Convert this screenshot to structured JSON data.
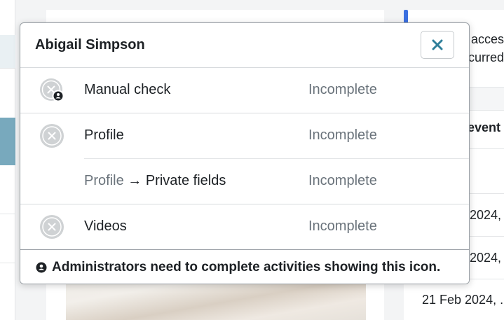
{
  "background": {
    "right_panel": {
      "line1": "acces",
      "line2": "curred",
      "header": "event",
      "dates": [
        "2024, .",
        "2024, .",
        "21 Feb 2024, ."
      ]
    }
  },
  "modal": {
    "title": "Abigail Simpson",
    "close_icon": "close-icon",
    "rows": [
      {
        "label": "Manual check",
        "status": "Incomplete",
        "icon": "incomplete-admin-icon"
      },
      {
        "label": "Profile",
        "status": "Incomplete",
        "icon": "incomplete-icon"
      },
      {
        "parent": "Profile",
        "arrow": "→",
        "label": "Private fields",
        "status": "Incomplete"
      },
      {
        "label": "Videos",
        "status": "Incomplete",
        "icon": "incomplete-icon"
      }
    ],
    "footer": {
      "icon": "admin-icon",
      "text": "Administrators need to complete activities showing this icon."
    }
  },
  "colors": {
    "close_x": "#2f7f9a",
    "status_circle": "#cfd2d4",
    "muted_text": "#6a737b",
    "accent_blue": "#3b6fe0"
  }
}
